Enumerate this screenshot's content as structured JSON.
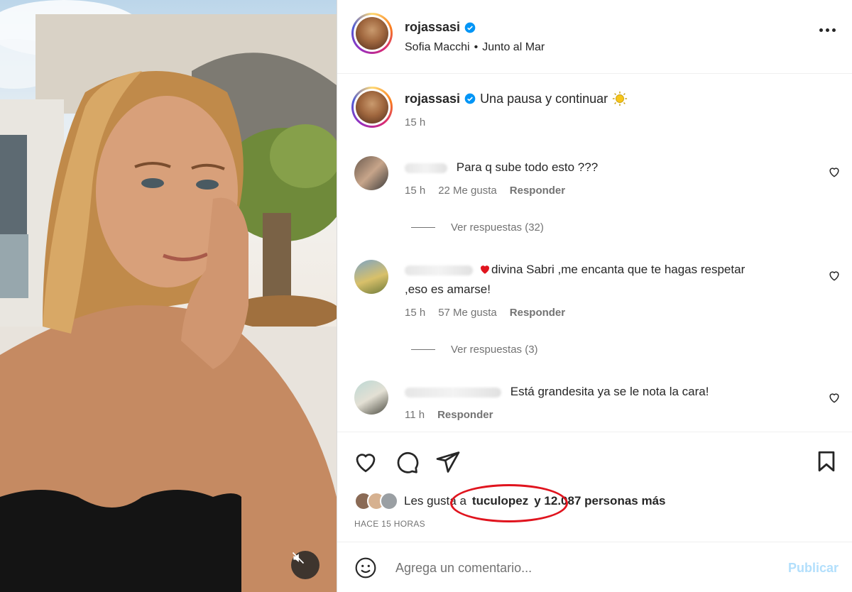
{
  "post": {
    "username": "rojassasi",
    "verified_icon": "verified-badge-icon",
    "audio_artist": "Sofia Macchi",
    "separator": "•",
    "audio_track": "Junto al Mar",
    "more_icon": "more-options-icon"
  },
  "caption": {
    "username": "rojassasi",
    "text": "Una pausa y continuar",
    "emoji": "sun-emoji",
    "time": "15 h"
  },
  "comments": [
    {
      "text": "Para q sube todo esto ???",
      "time": "15 h",
      "likes": "22 Me gusta",
      "reply": "Responder",
      "view_replies": "Ver respuestas (32)"
    },
    {
      "text_line1": "divina Sabri ,me encanta que te hagas respetar",
      "text_line2": ",eso es amarse!",
      "emoji": "red-heart-emoji",
      "time": "15 h",
      "likes": "57 Me gusta",
      "reply": "Responder",
      "view_replies": "Ver respuestas (3)"
    },
    {
      "text": "Está grandesita ya se le nota la cara!",
      "time": "11 h",
      "reply": "Responder"
    }
  ],
  "likes": {
    "prefix": "Les gusta a",
    "user": "tuculopez",
    "suffix": "y 12.087 personas más"
  },
  "time_ago": "HACE 15 HORAS",
  "comment_box": {
    "placeholder": "Agrega un comentario...",
    "publish": "Publicar"
  },
  "colors": {
    "verified": "#0095f6",
    "publish_disabled": "#b2dffc",
    "highlight_circle": "#e0141e"
  }
}
